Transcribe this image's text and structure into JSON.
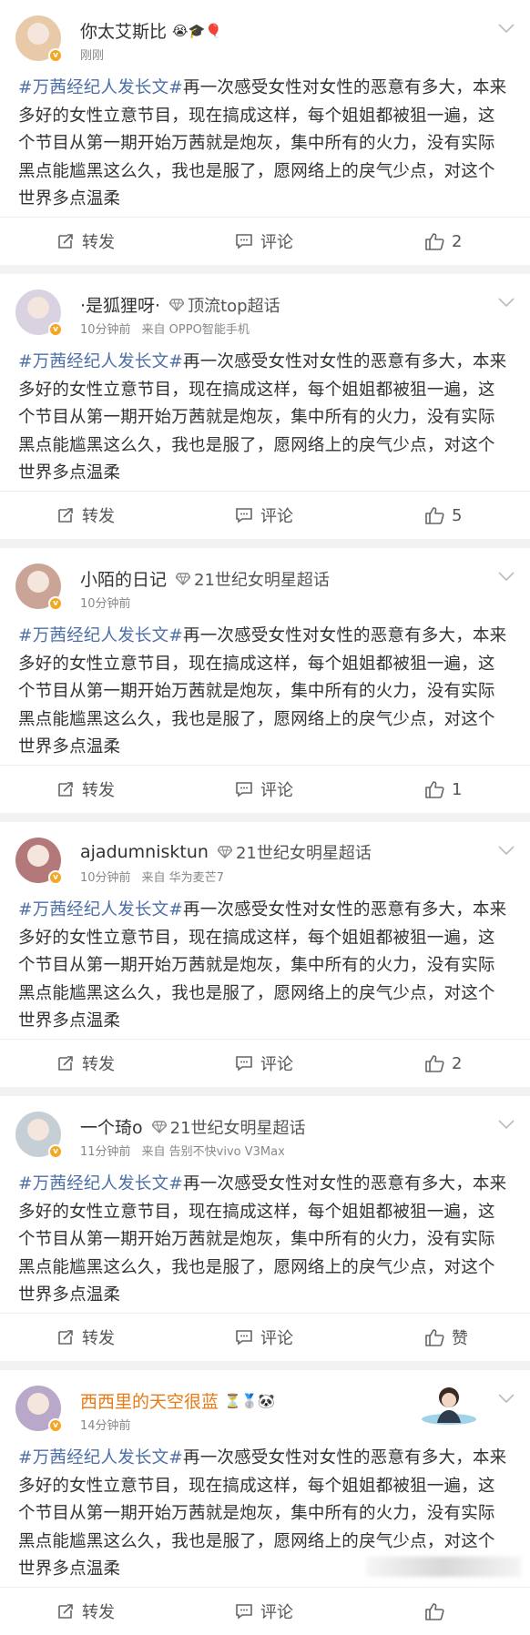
{
  "content_text": {
    "hashtag": "#万茜经纪人发长文#",
    "body": "再一次感受女性对女性的恶意有多大，本来多好的女性立意节目，现在搞成这样，每个姐姐都被狙一遍，这个节目从第一期开始万茜就是炮灰，集中所有的火力，没有实际黑点能尴黑这么久，我也是服了，愿网络上的戾气少点，对这个世界多点温柔"
  },
  "labels": {
    "repost": "转发",
    "comment": "评论"
  },
  "posts": [
    {
      "username": "你太艾斯比",
      "username_color": "#333333",
      "emojis": "😭🎓🎈",
      "topic": "",
      "time": "刚刚",
      "source": "",
      "likes": "2",
      "avatar_color": "#e8c9a8"
    },
    {
      "username": "·是狐狸呀·",
      "username_color": "#333333",
      "emojis": "",
      "topic": "顶流top超话",
      "time": "10分钟前",
      "source": "来自 OPPO智能手机",
      "likes": "5",
      "avatar_color": "#d9d2e0"
    },
    {
      "username": "小陌的日记",
      "username_color": "#333333",
      "emojis": "",
      "topic": "21世纪女明星超话",
      "time": "10分钟前",
      "source": "",
      "likes": "1",
      "avatar_color": "#caa597"
    },
    {
      "username": "ajadumnisktun",
      "username_color": "#333333",
      "emojis": "",
      "topic": "21世纪女明星超话",
      "time": "10分钟前",
      "source": "来自 华为麦芒7",
      "likes": "2",
      "avatar_color": "#b3787a"
    },
    {
      "username": "一个琦o",
      "username_color": "#333333",
      "emojis": "",
      "topic": "21世纪女明星超话",
      "time": "11分钟前",
      "source": "来自 告别不快vivo V3Max",
      "likes": "赞",
      "avatar_color": "#c7cfd6"
    },
    {
      "username": "西西里的天空很蓝",
      "username_color": "#e97a14",
      "emojis": "⏳🥈🐼",
      "topic": "",
      "time": "14分钟前",
      "source": "",
      "likes": "",
      "avatar_color": "#b9a8c9"
    }
  ]
}
